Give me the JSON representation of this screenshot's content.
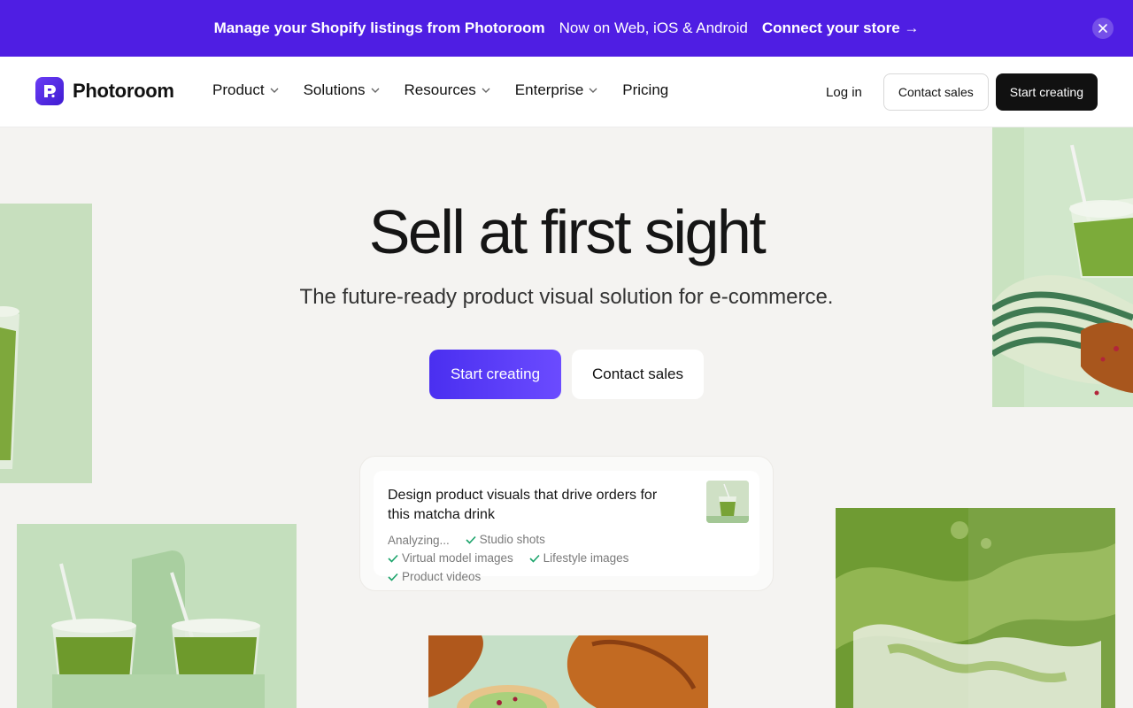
{
  "banner": {
    "text1": "Manage your Shopify listings from Photoroom",
    "text2": "Now on Web, iOS & Android",
    "link": "Connect your store →",
    "color": "#4f1ee3"
  },
  "nav": {
    "brand": "Photoroom",
    "menu": [
      {
        "label": "Product",
        "icon": "chevron-down-icon"
      },
      {
        "label": "Solutions",
        "icon": "chevron-down-icon"
      },
      {
        "label": "Resources",
        "icon": "chevron-down-icon"
      },
      {
        "label": "Enterprise",
        "icon": "chevron-down-icon"
      },
      {
        "label": "Pricing"
      }
    ],
    "login": "Log in",
    "contact": "Contact sales",
    "start": "Start creating"
  },
  "hero": {
    "title": "Sell at first sight",
    "subtitle": "The future-ready product visual solution for e-commerce.",
    "primary_cta": "Start creating",
    "secondary_cta": "Contact sales"
  },
  "prompt_card": {
    "prompt": "Design product visuals that drive orders for this matcha drink",
    "status": "Analyzing...",
    "steps": [
      "Studio shots",
      "Virtual model images",
      "Lifestyle images",
      "Product videos"
    ],
    "check_color": "#1aa36a"
  },
  "images": [
    {
      "name": "matcha-drink-left-image"
    },
    {
      "name": "matcha-bag-pastry-image"
    },
    {
      "name": "matcha-carrier-image"
    },
    {
      "name": "matcha-swirl-image"
    },
    {
      "name": "pastries-image"
    }
  ]
}
